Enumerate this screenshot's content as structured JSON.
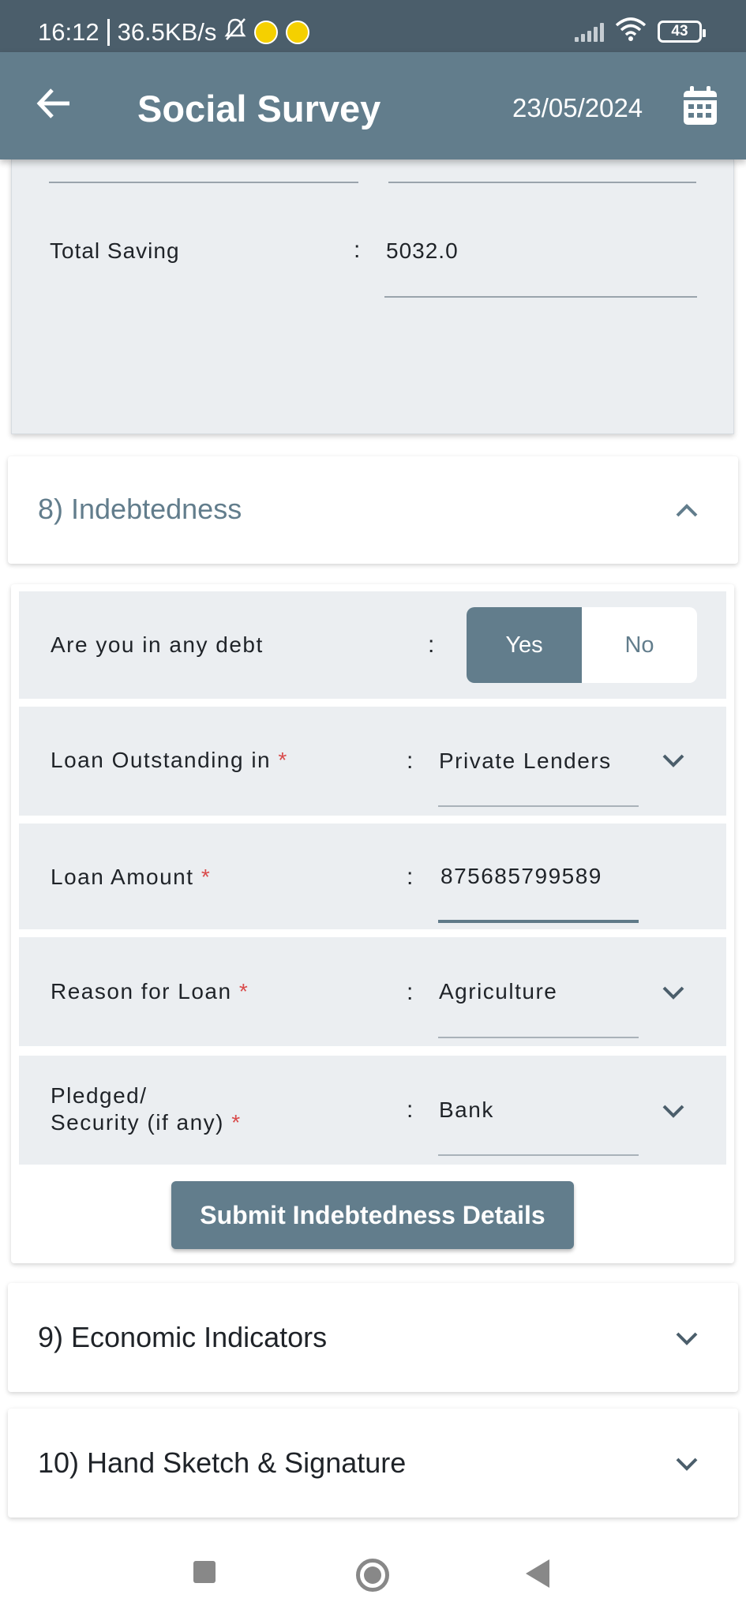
{
  "status_bar": {
    "time": "16:12",
    "speed": "36.5KB/s",
    "battery": "43"
  },
  "app_bar": {
    "title": "Social Survey",
    "date": "23/05/2024"
  },
  "savings": {
    "total_saving_label": "Total Saving",
    "total_saving_value": "5032.0",
    "colon": ":"
  },
  "indebtedness": {
    "header": "8) Indebtedness",
    "debt_question": "Are you in any debt",
    "yes_label": "Yes",
    "no_label": "No",
    "selected": "Yes",
    "loan_outstanding_label": "Loan Outstanding in",
    "loan_outstanding_value": "Private Lenders",
    "loan_amount_label": "Loan Amount",
    "loan_amount_value": "875685799589",
    "reason_label": "Reason for Loan",
    "reason_value": "Agriculture",
    "pledged_label_line1": "Pledged/",
    "pledged_label_line2": "Security (if any)",
    "pledged_value": "Bank",
    "required_mark": "*",
    "colon": ":",
    "submit_label": "Submit Indebtedness Details"
  },
  "sections": {
    "economic": "9) Economic Indicators",
    "hand_sketch": "10) Hand Sketch & Signature"
  },
  "colors": {
    "app_bar": "#627d8c",
    "status_bar": "#4b5e6b",
    "row_bg": "#ebeef1",
    "required": "#d94b4b"
  },
  "icons": {
    "back": "back-arrow-icon",
    "calendar": "calendar-icon",
    "expand": "chevron-down-icon",
    "collapse": "chevron-up-icon"
  }
}
